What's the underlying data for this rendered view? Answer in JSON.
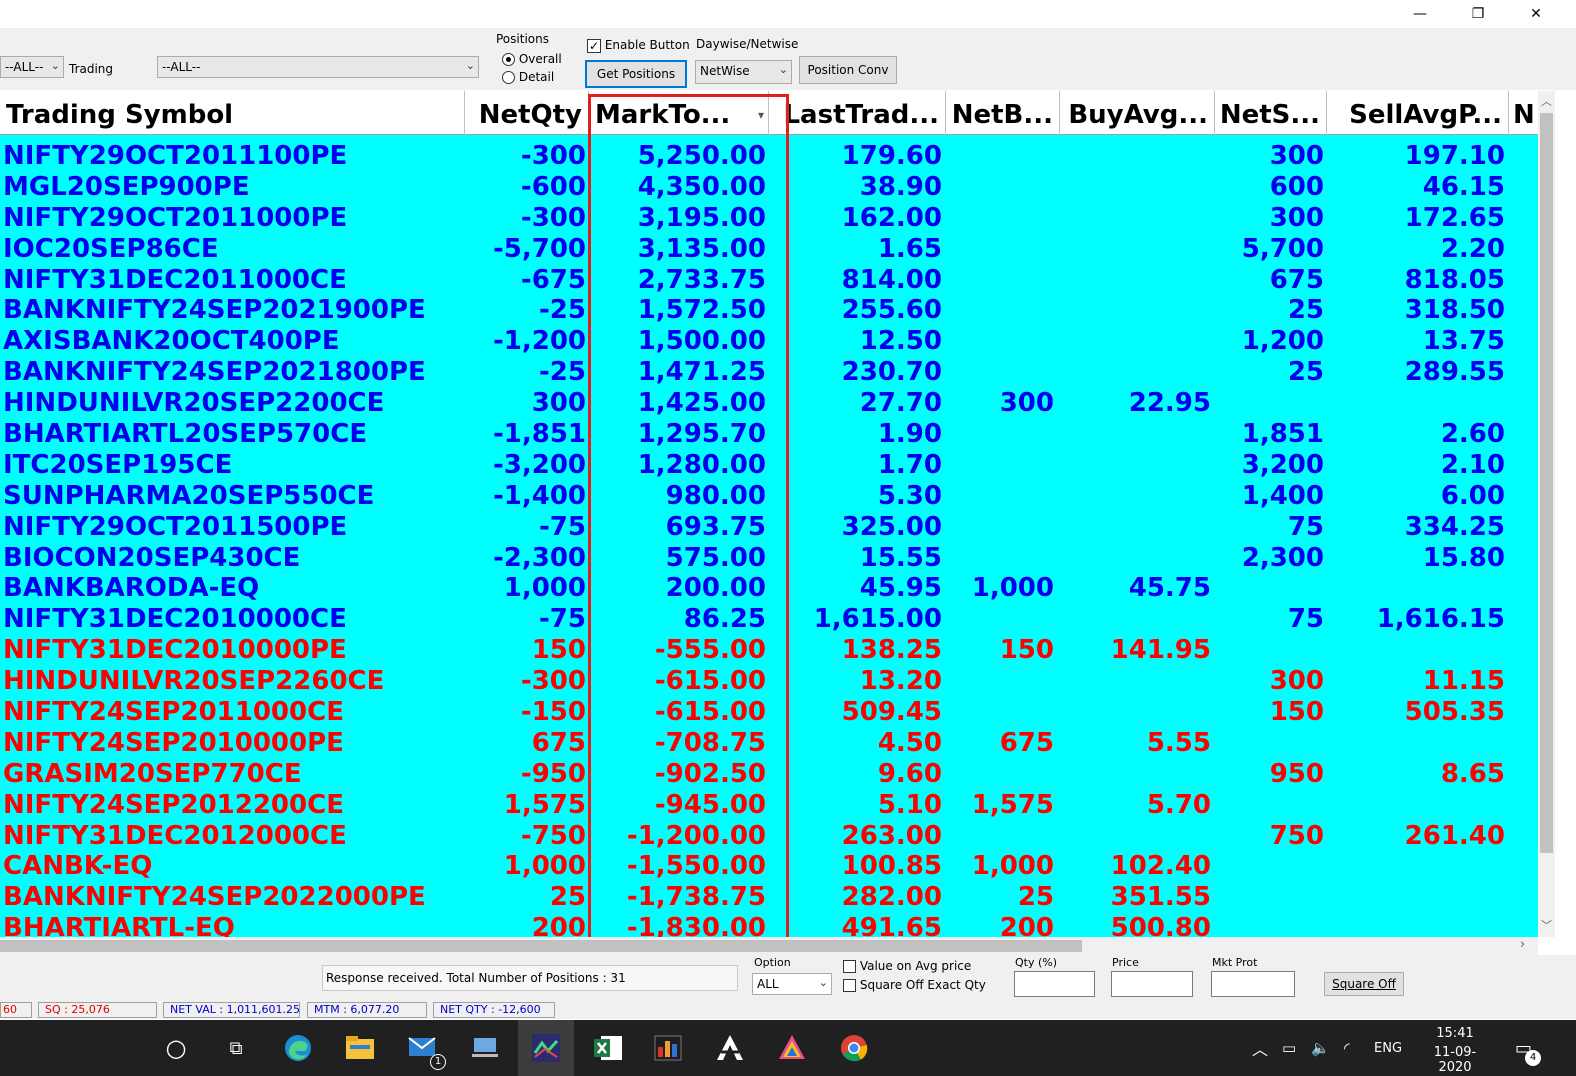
{
  "window": {
    "minimize_glyph": "—",
    "maximize_glyph": "❐",
    "close_glyph": "✕"
  },
  "toolbar": {
    "filter1_value": "--ALL--",
    "trading_label": "Trading",
    "trading_value": "--ALL--",
    "positions_group_label": "Positions",
    "overall_label": "Overall",
    "detail_label": "Detail",
    "enable_button_label": "Enable Button",
    "get_positions_label": "Get Positions",
    "daywise_label": "Daywise/Netwise",
    "netwise_value": "NetWise",
    "position_conv_label": "Position Conv"
  },
  "grid": {
    "columns": [
      "Trading Symbol",
      "NetQty",
      "MarkTo...",
      "LastTrad...",
      "NetB...",
      "BuyAvg...",
      "NetS...",
      "SellAvgP...",
      "N"
    ],
    "rows": [
      {
        "sym": "NIFTY29OCT2011100PE",
        "qty": "-300",
        "mtm": "5,250.00",
        "ltp": "179.60",
        "nb": "",
        "ba": "",
        "ns": "300",
        "sa": "197.10",
        "dir": "pos"
      },
      {
        "sym": "MGL20SEP900PE",
        "qty": "-600",
        "mtm": "4,350.00",
        "ltp": "38.90",
        "nb": "",
        "ba": "",
        "ns": "600",
        "sa": "46.15",
        "dir": "pos"
      },
      {
        "sym": "NIFTY29OCT2011000PE",
        "qty": "-300",
        "mtm": "3,195.00",
        "ltp": "162.00",
        "nb": "",
        "ba": "",
        "ns": "300",
        "sa": "172.65",
        "dir": "pos"
      },
      {
        "sym": "IOC20SEP86CE",
        "qty": "-5,700",
        "mtm": "3,135.00",
        "ltp": "1.65",
        "nb": "",
        "ba": "",
        "ns": "5,700",
        "sa": "2.20",
        "dir": "pos"
      },
      {
        "sym": "NIFTY31DEC2011000CE",
        "qty": "-675",
        "mtm": "2,733.75",
        "ltp": "814.00",
        "nb": "",
        "ba": "",
        "ns": "675",
        "sa": "818.05",
        "dir": "pos"
      },
      {
        "sym": "BANKNIFTY24SEP2021900PE",
        "qty": "-25",
        "mtm": "1,572.50",
        "ltp": "255.60",
        "nb": "",
        "ba": "",
        "ns": "25",
        "sa": "318.50",
        "dir": "pos"
      },
      {
        "sym": "AXISBANK20OCT400PE",
        "qty": "-1,200",
        "mtm": "1,500.00",
        "ltp": "12.50",
        "nb": "",
        "ba": "",
        "ns": "1,200",
        "sa": "13.75",
        "dir": "pos"
      },
      {
        "sym": "BANKNIFTY24SEP2021800PE",
        "qty": "-25",
        "mtm": "1,471.25",
        "ltp": "230.70",
        "nb": "",
        "ba": "",
        "ns": "25",
        "sa": "289.55",
        "dir": "pos"
      },
      {
        "sym": "HINDUNILVR20SEP2200CE",
        "qty": "300",
        "mtm": "1,425.00",
        "ltp": "27.70",
        "nb": "300",
        "ba": "22.95",
        "ns": "",
        "sa": "",
        "dir": "pos"
      },
      {
        "sym": "BHARTIARTL20SEP570CE",
        "qty": "-1,851",
        "mtm": "1,295.70",
        "ltp": "1.90",
        "nb": "",
        "ba": "",
        "ns": "1,851",
        "sa": "2.60",
        "dir": "pos"
      },
      {
        "sym": "ITC20SEP195CE",
        "qty": "-3,200",
        "mtm": "1,280.00",
        "ltp": "1.70",
        "nb": "",
        "ba": "",
        "ns": "3,200",
        "sa": "2.10",
        "dir": "pos"
      },
      {
        "sym": "SUNPHARMA20SEP550CE",
        "qty": "-1,400",
        "mtm": "980.00",
        "ltp": "5.30",
        "nb": "",
        "ba": "",
        "ns": "1,400",
        "sa": "6.00",
        "dir": "pos"
      },
      {
        "sym": "NIFTY29OCT2011500PE",
        "qty": "-75",
        "mtm": "693.75",
        "ltp": "325.00",
        "nb": "",
        "ba": "",
        "ns": "75",
        "sa": "334.25",
        "dir": "pos"
      },
      {
        "sym": "BIOCON20SEP430CE",
        "qty": "-2,300",
        "mtm": "575.00",
        "ltp": "15.55",
        "nb": "",
        "ba": "",
        "ns": "2,300",
        "sa": "15.80",
        "dir": "pos"
      },
      {
        "sym": "BANKBARODA-EQ",
        "qty": "1,000",
        "mtm": "200.00",
        "ltp": "45.95",
        "nb": "1,000",
        "ba": "45.75",
        "ns": "",
        "sa": "",
        "dir": "pos"
      },
      {
        "sym": "NIFTY31DEC2010000CE",
        "qty": "-75",
        "mtm": "86.25",
        "ltp": "1,615.00",
        "nb": "",
        "ba": "",
        "ns": "75",
        "sa": "1,616.15",
        "dir": "pos"
      },
      {
        "sym": "NIFTY31DEC2010000PE",
        "qty": "150",
        "mtm": "-555.00",
        "ltp": "138.25",
        "nb": "150",
        "ba": "141.95",
        "ns": "",
        "sa": "",
        "dir": "neg"
      },
      {
        "sym": "HINDUNILVR20SEP2260CE",
        "qty": "-300",
        "mtm": "-615.00",
        "ltp": "13.20",
        "nb": "",
        "ba": "",
        "ns": "300",
        "sa": "11.15",
        "dir": "neg"
      },
      {
        "sym": "NIFTY24SEP2011000CE",
        "qty": "-150",
        "mtm": "-615.00",
        "ltp": "509.45",
        "nb": "",
        "ba": "",
        "ns": "150",
        "sa": "505.35",
        "dir": "neg"
      },
      {
        "sym": "NIFTY24SEP2010000PE",
        "qty": "675",
        "mtm": "-708.75",
        "ltp": "4.50",
        "nb": "675",
        "ba": "5.55",
        "ns": "",
        "sa": "",
        "dir": "neg"
      },
      {
        "sym": "GRASIM20SEP770CE",
        "qty": "-950",
        "mtm": "-902.50",
        "ltp": "9.60",
        "nb": "",
        "ba": "",
        "ns": "950",
        "sa": "8.65",
        "dir": "neg"
      },
      {
        "sym": "NIFTY24SEP2012200CE",
        "qty": "1,575",
        "mtm": "-945.00",
        "ltp": "5.10",
        "nb": "1,575",
        "ba": "5.70",
        "ns": "",
        "sa": "",
        "dir": "neg"
      },
      {
        "sym": "NIFTY31DEC2012000CE",
        "qty": "-750",
        "mtm": "-1,200.00",
        "ltp": "263.00",
        "nb": "",
        "ba": "",
        "ns": "750",
        "sa": "261.40",
        "dir": "neg"
      },
      {
        "sym": "CANBK-EQ",
        "qty": "1,000",
        "mtm": "-1,550.00",
        "ltp": "100.85",
        "nb": "1,000",
        "ba": "102.40",
        "ns": "",
        "sa": "",
        "dir": "neg"
      },
      {
        "sym": "BANKNIFTY24SEP2022000PE",
        "qty": "25",
        "mtm": "-1,738.75",
        "ltp": "282.00",
        "nb": "25",
        "ba": "351.55",
        "ns": "",
        "sa": "",
        "dir": "neg"
      },
      {
        "sym": "BHARTIARTL-EQ",
        "qty": "200",
        "mtm": "-1,830.00",
        "ltp": "491.65",
        "nb": "200",
        "ba": "500.80",
        "ns": "",
        "sa": "",
        "dir": "neg"
      }
    ]
  },
  "bottom": {
    "response_text": "Response received. Total Number of Positions : 31",
    "option_label": "Option",
    "option_value": "ALL",
    "value_on_avg_label": "Value on Avg  price",
    "square_off_exact_label": "Square Off Exact Qty",
    "qty_label": "Qty (%)",
    "price_label": "Price",
    "mkt_prot_label": "Mkt Prot",
    "square_off_button": "Square Off"
  },
  "status_bar": {
    "s1": "60",
    "sq": "SQ : 25,076",
    "net_val": "NET VAL : 1,011,601.25",
    "mtm": "MTM : 6,077.20",
    "net_qty": "NET QTY : -12,600"
  },
  "taskbar": {
    "lang": "ENG",
    "time": "15:41",
    "date": "11-09-2020",
    "notifications": "4",
    "mail_badge": "1"
  },
  "colors": {
    "grid_bg": "#00ffff",
    "profit_text": "#0000ee",
    "loss_text": "#ff0000",
    "highlight_box": "#e02020"
  }
}
